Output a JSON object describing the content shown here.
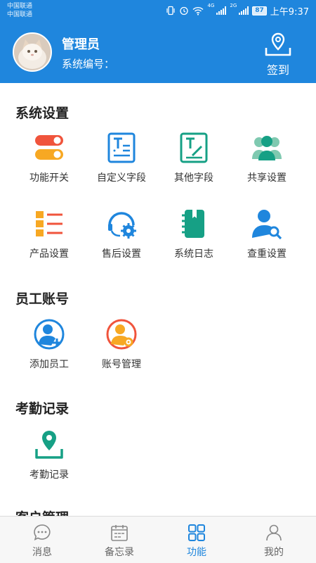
{
  "status_bar": {
    "carrier_1": "中国联通",
    "carrier_2": "中国联通",
    "network_1": "4G",
    "network_2": "2G",
    "battery": "87",
    "time": "上午9:37"
  },
  "header": {
    "user_name": "管理员",
    "user_id_label": "系统编号：",
    "checkin_label": "签到",
    "background_color": "#1f86dd"
  },
  "sections": [
    {
      "title": "系统设置",
      "items": [
        {
          "label": "功能开关",
          "icon": "toggle-switch-icon"
        },
        {
          "label": "自定义字段",
          "icon": "text-document-icon"
        },
        {
          "label": "其他字段",
          "icon": "text-edit-icon"
        },
        {
          "label": "共享设置",
          "icon": "users-share-icon"
        },
        {
          "label": "产品设置",
          "icon": "product-list-icon"
        },
        {
          "label": "售后设置",
          "icon": "headset-gear-icon"
        },
        {
          "label": "系统日志",
          "icon": "notebook-icon"
        },
        {
          "label": "查重设置",
          "icon": "user-search-icon"
        }
      ]
    },
    {
      "title": "员工账号",
      "items": [
        {
          "label": "添加员工",
          "icon": "add-user-icon"
        },
        {
          "label": "账号管理",
          "icon": "user-gear-icon"
        }
      ]
    },
    {
      "title": "考勤记录",
      "items": [
        {
          "label": "考勤记录",
          "icon": "location-pin-icon"
        }
      ]
    },
    {
      "title": "客户管理",
      "items": []
    }
  ],
  "tabbar": {
    "tabs": [
      {
        "label": "消息",
        "icon": "chat-bubble-icon"
      },
      {
        "label": "备忘录",
        "icon": "calendar-icon"
      },
      {
        "label": "功能",
        "icon": "grid-apps-icon"
      },
      {
        "label": "我的",
        "icon": "person-icon"
      }
    ],
    "active": "功能",
    "active_color": "#1f86dd"
  }
}
